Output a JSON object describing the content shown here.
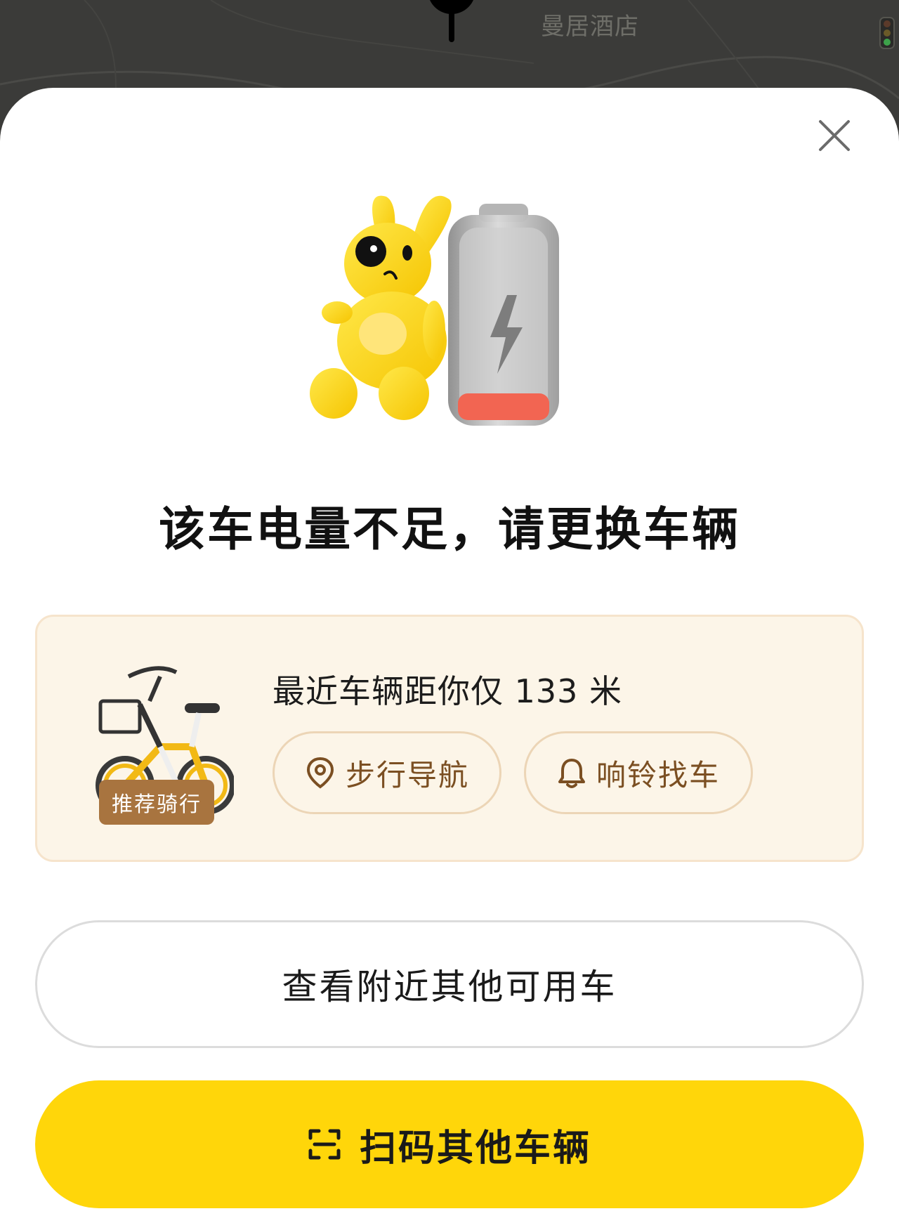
{
  "map": {
    "poi_label": "曼居酒店"
  },
  "dialog": {
    "headline": "该车电量不足，请更换车辆"
  },
  "nearest_card": {
    "tag": "推荐骑行",
    "distance_text": "最近车辆距你仅 133 米",
    "nav_button": "步行导航",
    "ring_button": "响铃找车"
  },
  "actions": {
    "view_nearby": "查看附近其他可用车",
    "scan_other": "扫码其他车辆"
  },
  "colors": {
    "primary_yellow": "#ffd60a",
    "card_bg": "#fcf5e8",
    "tag_brown": "#a8743f",
    "accent_brown": "#7b4f22",
    "battery_low_red": "#f26552"
  },
  "icons": [
    "close-icon",
    "location-pin-icon",
    "bell-icon",
    "scan-icon",
    "map-marker-icon",
    "traffic-light-icon"
  ]
}
